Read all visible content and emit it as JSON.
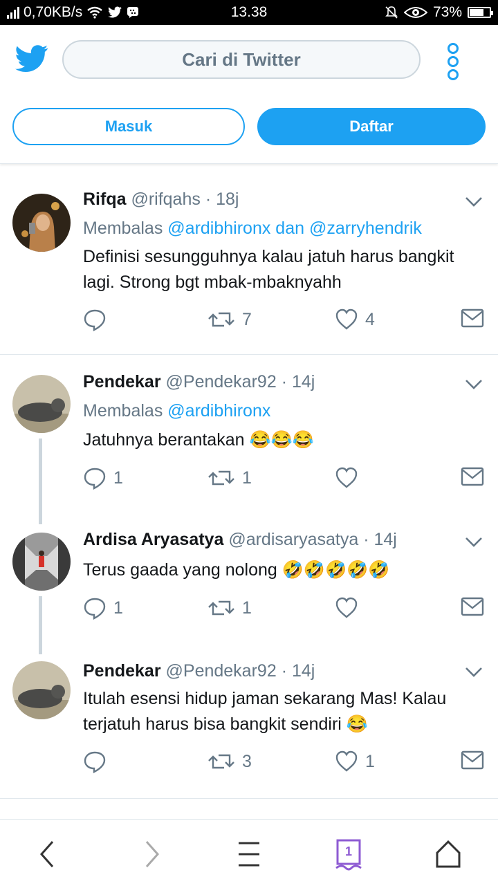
{
  "status": {
    "network_speed": "0,70KB/s",
    "time": "13.38",
    "battery": "73%",
    "battery_level": 0.73
  },
  "header": {
    "search_placeholder": "Cari di Twitter",
    "login_label": "Masuk",
    "signup_label": "Daftar"
  },
  "tweets": [
    {
      "name": "Rifqa",
      "handle": "@rifqahs",
      "time": "18j",
      "reply_prefix": "Membalas",
      "reply_mention_1": "@ardibhironx",
      "reply_and": "dan",
      "reply_mention_2": "@zarryhendrik",
      "text": "Definisi sesungguhnya kalau jatuh harus bangkit lagi. Strong bgt mbak-mbaknyahh",
      "replies": "",
      "retweets": "7",
      "likes": "4"
    },
    {
      "name": "Pendekar",
      "handle": "@Pendekar92",
      "time": "14j",
      "reply_prefix": "Membalas",
      "reply_mention_1": "@ardibhironx",
      "text": "Jatuhnya berantakan",
      "emoji": "😂😂😂",
      "replies": "1",
      "retweets": "1",
      "likes": ""
    },
    {
      "name": "Ardisa Aryasatya",
      "handle": "@ardisaryasatya",
      "time": "14j",
      "text": "Terus gaada yang nolong",
      "emoji": "🤣🤣🤣🤣🤣",
      "replies": "1",
      "retweets": "1",
      "likes": ""
    },
    {
      "name": "Pendekar",
      "handle": "@Pendekar92",
      "time": "14j",
      "text": "Itulah esensi hidup jaman sekarang Mas! Kalau terjatuh harus bisa bangkit sendiri",
      "emoji": "😂",
      "replies": "",
      "retweets": "3",
      "likes": "1"
    }
  ],
  "navbar": {
    "tab_count": "1"
  }
}
